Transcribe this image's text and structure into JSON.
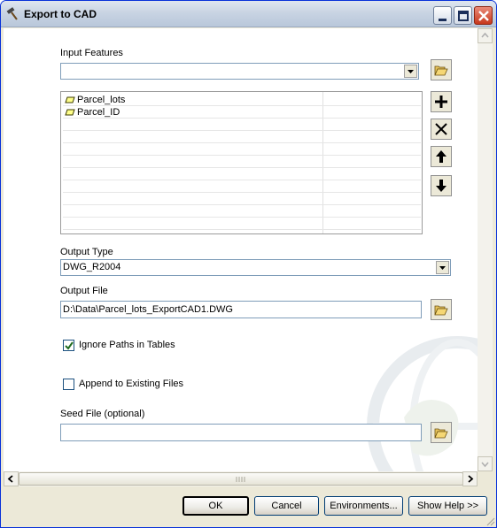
{
  "window": {
    "title": "Export to CAD"
  },
  "form": {
    "input_features_label": "Input Features",
    "input_features_value": "",
    "layers": [
      {
        "name": "Parcel_lots"
      },
      {
        "name": "Parcel_ID"
      }
    ],
    "output_type_label": "Output Type",
    "output_type_value": "DWG_R2004",
    "output_file_label": "Output File",
    "output_file_value": "D:\\Data\\Parcel_lots_ExportCAD1.DWG",
    "ignore_paths_label": "Ignore Paths in Tables",
    "ignore_paths_checked": true,
    "append_label": "Append to Existing Files",
    "append_checked": false,
    "seed_file_label": "Seed File (optional)",
    "seed_file_value": ""
  },
  "buttons": {
    "ok": "OK",
    "cancel": "Cancel",
    "environments": "Environments...",
    "show_help": "Show Help >>"
  },
  "icons": {
    "title": "hammer-icon",
    "browse": "open-folder-icon",
    "add": "plus-icon",
    "remove": "x-icon",
    "up": "arrow-up-icon",
    "down": "arrow-down-icon",
    "layer": "polygon-layer-icon"
  }
}
